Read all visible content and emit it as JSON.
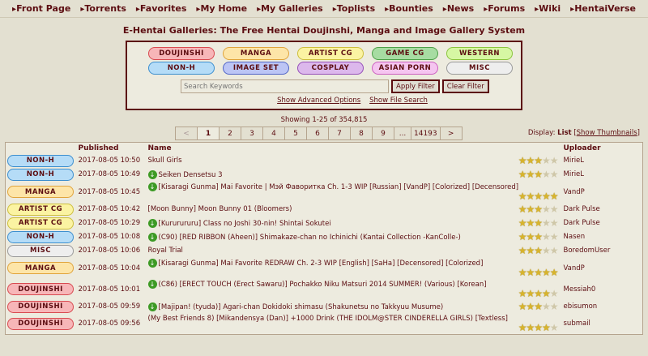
{
  "nav": [
    "Front Page",
    "Torrents",
    "Favorites",
    "My Home",
    "My Galleries",
    "Toplists",
    "Bounties",
    "News",
    "Forums",
    "Wiki",
    "HentaiVerse"
  ],
  "site_title": "E-Hentai Galleries: The Free Hentai Doujinshi, Manga and Image Gallery System",
  "categories": [
    {
      "label": "DOUJINSHI",
      "bg": "#f7b6b8",
      "border": "#d84a50"
    },
    {
      "label": "MANGA",
      "bg": "#fde5a8",
      "border": "#e0a43c"
    },
    {
      "label": "ARTIST CG",
      "bg": "#fbf3a2",
      "border": "#cdbf3d"
    },
    {
      "label": "GAME CG",
      "bg": "#a7dca2",
      "border": "#4da048"
    },
    {
      "label": "WESTERN",
      "bg": "#d6f7a3",
      "border": "#8bc53e"
    },
    {
      "label": "NON-H",
      "bg": "#b5dcf7",
      "border": "#3d8fcf"
    },
    {
      "label": "IMAGE SET",
      "bg": "#bcc5f5",
      "border": "#5165c7"
    },
    {
      "label": "COSPLAY",
      "bg": "#dcb8ec",
      "border": "#9650b9"
    },
    {
      "label": "ASIAN PORN",
      "bg": "#f5c5f0",
      "border": "#cc5fc0"
    },
    {
      "label": "MISC",
      "bg": "#eeeeee",
      "border": "#9a9a9a"
    }
  ],
  "search": {
    "placeholder": "Search Keywords",
    "apply": "Apply Filter",
    "clear": "Clear Filter",
    "advanced": "Show Advanced Options",
    "file_search": "Show File Search"
  },
  "showing": "Showing 1-25 of 354,815",
  "pager": [
    "<",
    "1",
    "2",
    "3",
    "4",
    "5",
    "6",
    "7",
    "8",
    "9",
    "...",
    "14193",
    ">"
  ],
  "display": {
    "label": "Display:",
    "list": "List",
    "thumbs": "Show Thumbnails"
  },
  "headers": {
    "published": "Published",
    "name": "Name",
    "uploader": "Uploader"
  },
  "rows": [
    {
      "cat": "NON-H",
      "bg": "#b5dcf7",
      "border": "#3d8fcf",
      "date": "2017-08-05 10:50",
      "dl": false,
      "name": "Skull Girls",
      "stars": 3,
      "uploader": "MirieL",
      "tall": false
    },
    {
      "cat": "NON-H",
      "bg": "#b5dcf7",
      "border": "#3d8fcf",
      "date": "2017-08-05 10:49",
      "dl": true,
      "name": "Seiken Densetsu 3",
      "stars": 3,
      "uploader": "MirieL",
      "tall": false
    },
    {
      "cat": "MANGA",
      "bg": "#fde5a8",
      "border": "#e0a43c",
      "date": "2017-08-05 10:45",
      "dl": true,
      "name": "[Kisaragi Gunma] Mai Favorite | Мэй Фаворитка Ch. 1-3 WIP [Russian] [VandP] [Colorized] [Decensored]",
      "stars": 5,
      "uploader": "VandP",
      "tall": true
    },
    {
      "cat": "ARTIST CG",
      "bg": "#fbf3a2",
      "border": "#cdbf3d",
      "date": "2017-08-05 10:42",
      "dl": false,
      "name": "[Moon Bunny] Moon Bunny 01 (Bloomers)",
      "stars": 3,
      "uploader": "Dark Pulse",
      "tall": false
    },
    {
      "cat": "ARTIST CG",
      "bg": "#fbf3a2",
      "border": "#cdbf3d",
      "date": "2017-08-05 10:29",
      "dl": true,
      "name": "[Kururururu] Class no Joshi 30-nin! Shintai Sokutei",
      "stars": 3,
      "uploader": "Dark Pulse",
      "tall": false
    },
    {
      "cat": "NON-H",
      "bg": "#b5dcf7",
      "border": "#3d8fcf",
      "date": "2017-08-05 10:08",
      "dl": true,
      "name": "(C90) [RED RIBBON (Aheen)] Shimakaze-chan no Ichinichi (Kantai Collection -KanColle-)",
      "stars": 3,
      "uploader": "Nasen",
      "tall": false
    },
    {
      "cat": "MISC",
      "bg": "#eeeeee",
      "border": "#9a9a9a",
      "date": "2017-08-05 10:06",
      "dl": false,
      "name": "Royal Trial",
      "stars": 3,
      "uploader": "BoredomUser",
      "tall": false
    },
    {
      "cat": "MANGA",
      "bg": "#fde5a8",
      "border": "#e0a43c",
      "date": "2017-08-05 10:04",
      "dl": true,
      "name": "[Kisaragi Gunma] Mai Favorite REDRAW Ch. 2-3 WIP [English] [SaHa] [Decensored] [Colorized]",
      "stars": 5,
      "uploader": "VandP",
      "tall": true
    },
    {
      "cat": "DOUJINSHI",
      "bg": "#f7b6b8",
      "border": "#d84a50",
      "date": "2017-08-05 10:01",
      "dl": true,
      "name": "(C86) [ERECT TOUCH (Erect Sawaru)] Pochakko Niku Matsuri 2014 SUMMER! (Various) [Korean]",
      "stars": 4,
      "uploader": "Messiah0",
      "tall": true
    },
    {
      "cat": "DOUJINSHI",
      "bg": "#f7b6b8",
      "border": "#d84a50",
      "date": "2017-08-05 09:59",
      "dl": true,
      "name": "[Majipan! (tyuda)] Agari-chan Dokidoki shimasu (Shakunetsu no Takkyuu Musume)",
      "stars": 3,
      "uploader": "ebisumon",
      "tall": false
    },
    {
      "cat": "DOUJINSHI",
      "bg": "#f7b6b8",
      "border": "#d84a50",
      "date": "2017-08-05 09:56",
      "dl": false,
      "name": "(My Best Friends 8) [Mikandensya (Dan)] +1000 Drink (THE IDOLM@STER CINDERELLA GIRLS) [Textless]",
      "stars": 4,
      "uploader": "submail",
      "tall": true
    }
  ]
}
